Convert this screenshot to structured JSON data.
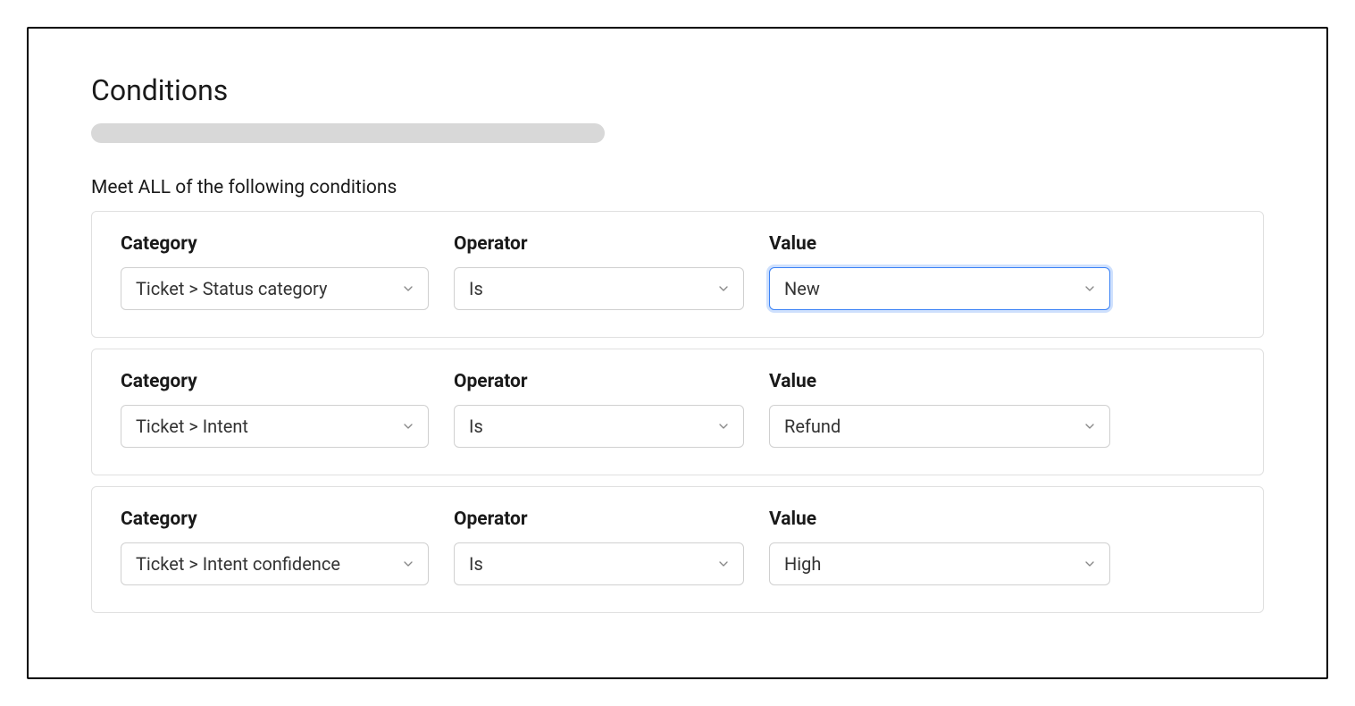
{
  "title": "Conditions",
  "subtitle": "Meet ALL of the following conditions",
  "labels": {
    "category": "Category",
    "operator": "Operator",
    "value": "Value"
  },
  "conditions": [
    {
      "category": "Ticket > Status category",
      "operator": "Is",
      "value": "New",
      "value_focused": true
    },
    {
      "category": "Ticket > Intent",
      "operator": "Is",
      "value": "Refund",
      "value_focused": false
    },
    {
      "category": "Ticket > Intent confidence",
      "operator": "Is",
      "value": "High",
      "value_focused": false
    }
  ]
}
